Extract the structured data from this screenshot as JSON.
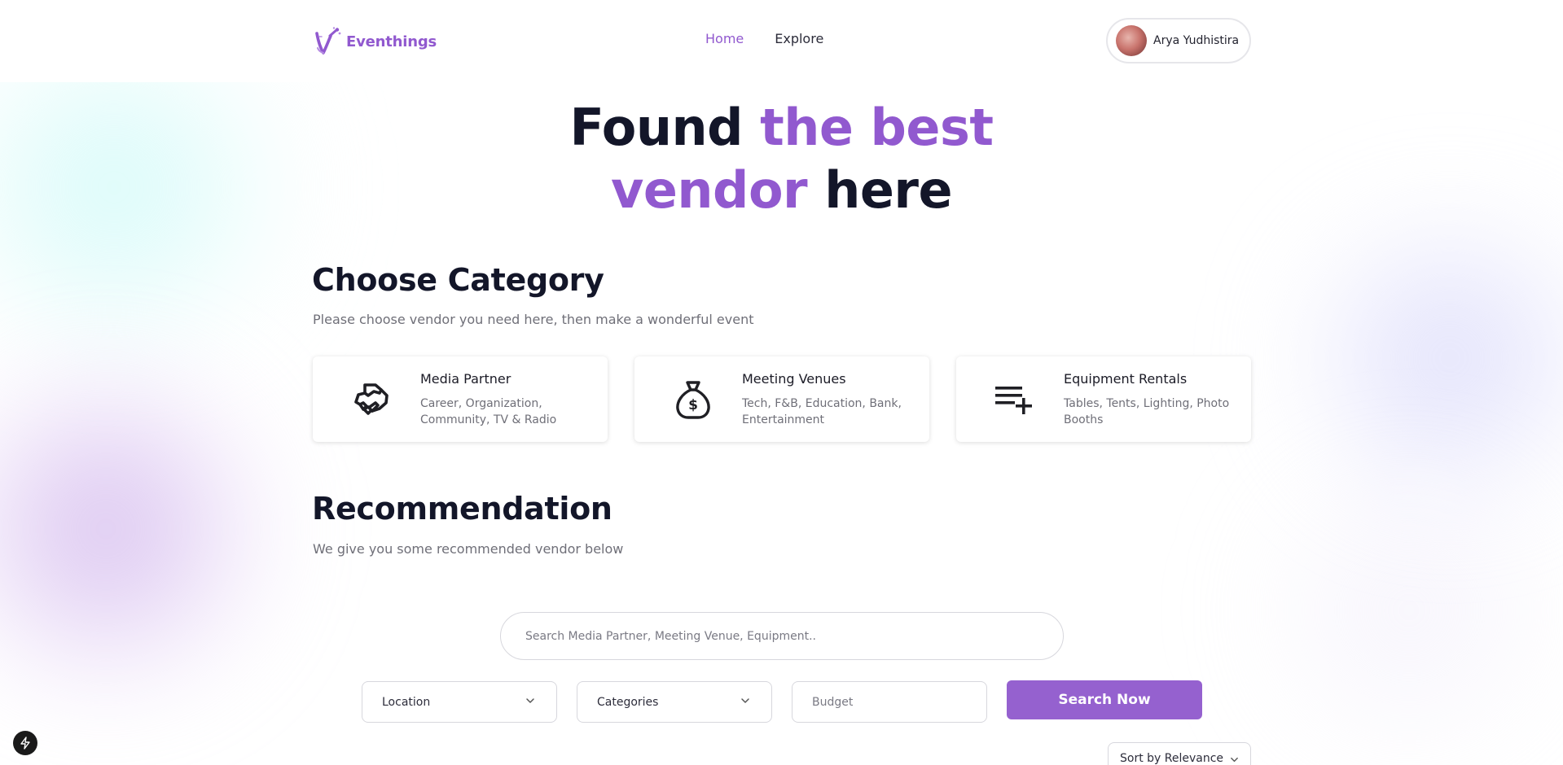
{
  "brand": {
    "name": "Eventhings",
    "accent": "#9159cf"
  },
  "nav": {
    "items": [
      {
        "label": "Home",
        "active": true
      },
      {
        "label": "Explore",
        "active": false
      }
    ]
  },
  "user": {
    "name": "Arya Yudhistira"
  },
  "hero": {
    "line1_dark": "Found",
    "line1_purple": "the best",
    "line2_purple": "vendor",
    "line2_dark": "here"
  },
  "category_section": {
    "title": "Choose Category",
    "subtitle": "Please choose vendor you need here, then make a wonderful event",
    "cards": [
      {
        "title": "Media Partner",
        "description": "Career, Organization, Community, TV & Radio",
        "icon": "handshake-icon"
      },
      {
        "title": "Meeting Venues",
        "description": "Tech, F&B, Education, Bank, Entertainment",
        "icon": "money-bag-icon"
      },
      {
        "title": "Equipment Rentals",
        "description": "Tables, Tents, Lighting, Photo Booths",
        "icon": "playlist-add-icon"
      }
    ]
  },
  "recommendation": {
    "title": "Recommendation",
    "subtitle": "We give you some recommended vendor below"
  },
  "search": {
    "placeholder": "Search Media Partner, Meeting Venue, Equipment..",
    "location_label": "Location",
    "categories_label": "Categories",
    "budget_placeholder": "Budget",
    "button_label": "Search Now",
    "sort_label": "Sort by Relevance"
  }
}
